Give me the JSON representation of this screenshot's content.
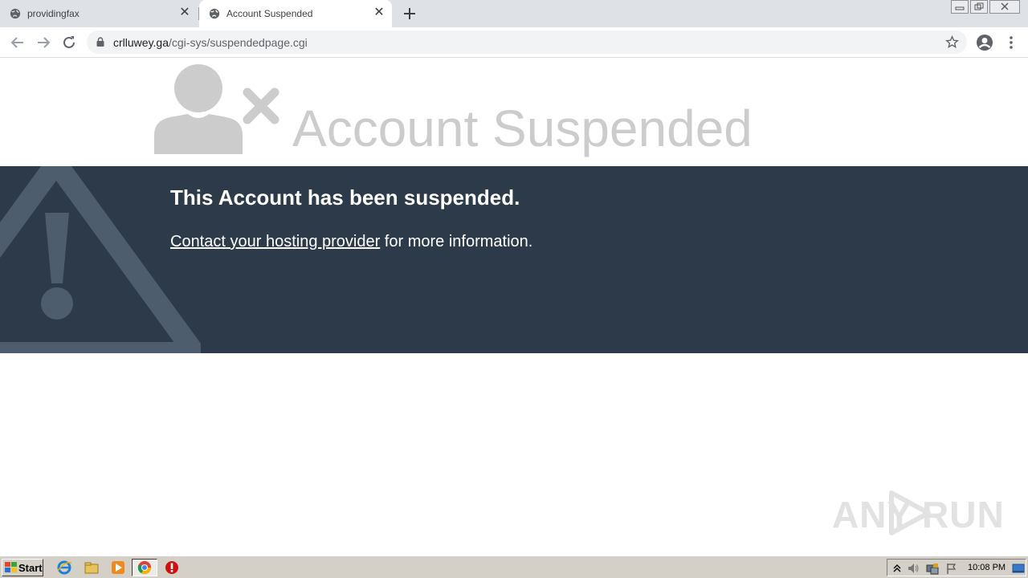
{
  "browser": {
    "tabs": [
      {
        "title": "providingfax",
        "active": false
      },
      {
        "title": "Account Suspended",
        "active": true
      }
    ],
    "url": {
      "domain": "crlluwey.ga",
      "path": "/cgi-sys/suspendedpage.cgi"
    }
  },
  "page": {
    "headline": "Account Suspended",
    "banner_title": "This Account has been suspended.",
    "banner_link": "Contact your hosting provider",
    "banner_rest": " for more information.",
    "colors": {
      "banner": "#2c3a4a",
      "headline": "#cccccc",
      "icon": "#cccccc",
      "warn_icon": "#4d5d6e"
    }
  },
  "watermark": {
    "text_left": "ANY",
    "text_right": "RUN"
  },
  "taskbar": {
    "start_label": "Start",
    "clock": "10:08 PM",
    "apps": [
      "ie-icon",
      "explorer-icon",
      "media-player-icon",
      "chrome-icon",
      "stop-icon"
    ]
  }
}
